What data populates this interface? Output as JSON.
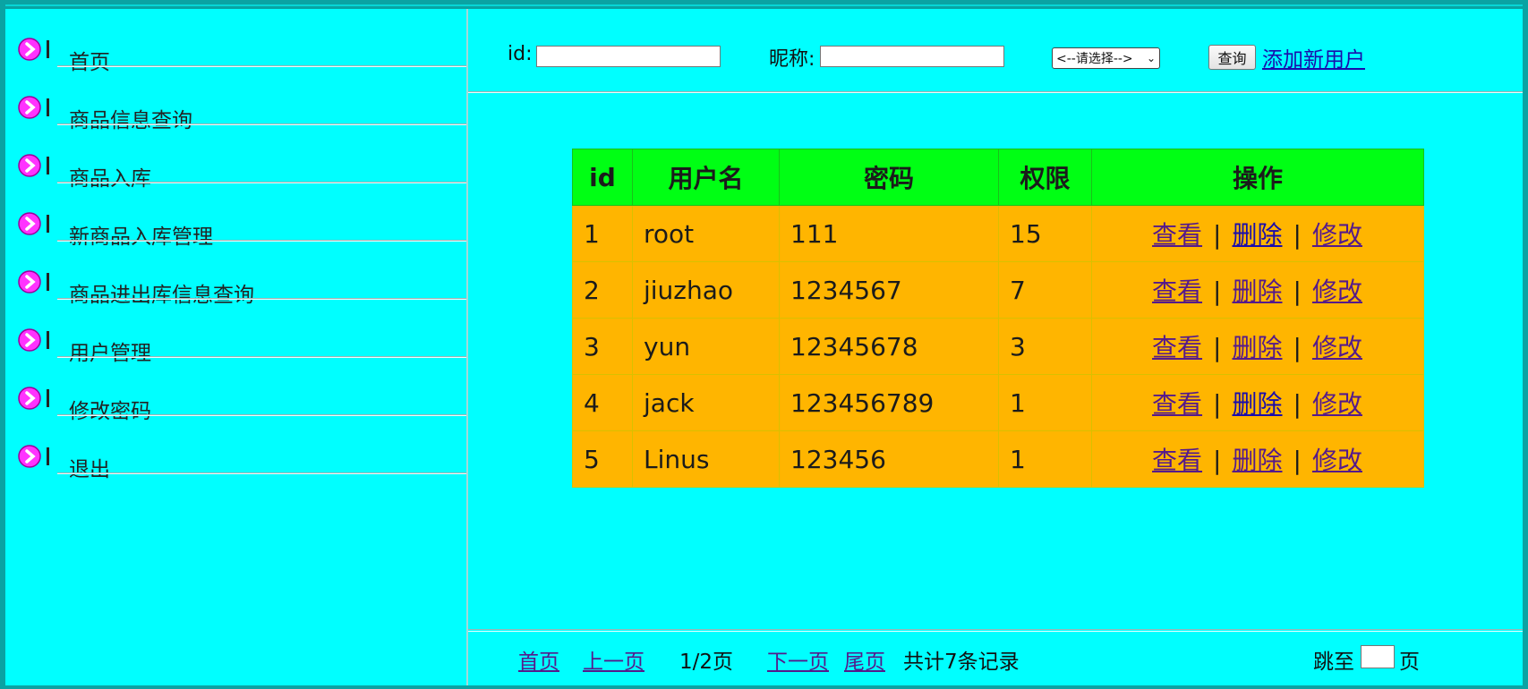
{
  "sidebar": {
    "items": [
      {
        "label": "首页"
      },
      {
        "label": "商品信息查询"
      },
      {
        "label": "商品入库"
      },
      {
        "label": "新商品入库管理"
      },
      {
        "label": "商品进出库信息查询"
      },
      {
        "label": "用户管理"
      },
      {
        "label": "修改密码"
      },
      {
        "label": "退出"
      }
    ],
    "icon": "arrow-circle-icon"
  },
  "search": {
    "id_label": "id:",
    "id_value": "",
    "nickname_label": "昵称:",
    "nickname_value": "",
    "select_value": "<--请选择-->",
    "query_button": "查询",
    "add_link": "添加新用户"
  },
  "table": {
    "headers": [
      "id",
      "用户名",
      "密码",
      "权限",
      "操作"
    ],
    "rows": [
      {
        "id": "1",
        "username": "root",
        "password": "111",
        "permission": "15"
      },
      {
        "id": "2",
        "username": "jiuzhao",
        "password": "1234567",
        "permission": "7"
      },
      {
        "id": "3",
        "username": "yun",
        "password": "12345678",
        "permission": "3"
      },
      {
        "id": "4",
        "username": "jack",
        "password": "123456789",
        "permission": "1"
      },
      {
        "id": "5",
        "username": "Linus",
        "password": "123456",
        "permission": "1"
      }
    ],
    "actions": {
      "view": "查看",
      "delete": "删除",
      "edit": "修改",
      "separator": "|"
    }
  },
  "pagination": {
    "first": "首页",
    "prev": "上一页",
    "current": "1/2页",
    "next": "下一页",
    "last": "尾页",
    "total": "共计7条记录",
    "jump_label": "跳至",
    "jump_value": "",
    "page_suffix": "页"
  },
  "colors": {
    "background": "#00ffff",
    "header_row": "#00ff14",
    "data_row": "#ffb500",
    "icon": "#ff33ff"
  }
}
